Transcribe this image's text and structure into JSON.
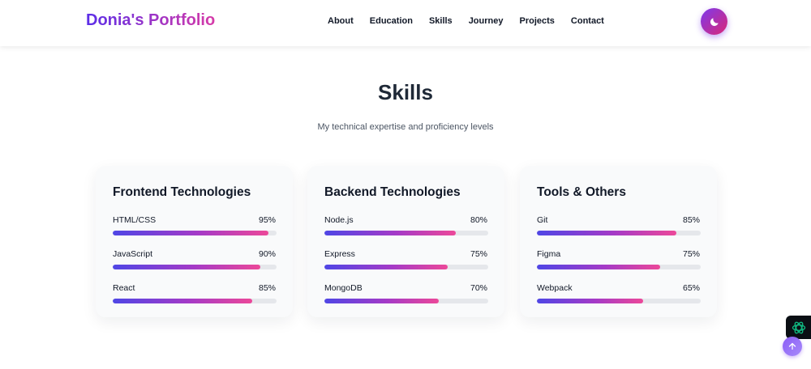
{
  "nav": {
    "brand": "Donia's Portfolio",
    "links": [
      "About",
      "Education",
      "Skills",
      "Journey",
      "Projects",
      "Contact"
    ],
    "theme_toggle_icon": "moon-icon"
  },
  "section": {
    "title": "Skills",
    "subtitle": "My technical expertise and proficiency levels"
  },
  "cards": [
    {
      "title": "Frontend Technologies",
      "skills": [
        {
          "name": "HTML/CSS",
          "percent_label": "95%",
          "level": 95
        },
        {
          "name": "JavaScript",
          "percent_label": "90%",
          "level": 90
        },
        {
          "name": "React",
          "percent_label": "85%",
          "level": 85
        }
      ]
    },
    {
      "title": "Backend Technologies",
      "skills": [
        {
          "name": "Node.js",
          "percent_label": "80%",
          "level": 80
        },
        {
          "name": "Express",
          "percent_label": "75%",
          "level": 75
        },
        {
          "name": "MongoDB",
          "percent_label": "70%",
          "level": 70
        }
      ]
    },
    {
      "title": "Tools & Others",
      "skills": [
        {
          "name": "Git",
          "percent_label": "85%",
          "level": 85
        },
        {
          "name": "Figma",
          "percent_label": "75%",
          "level": 75
        },
        {
          "name": "Webpack",
          "percent_label": "65%",
          "level": 65
        }
      ]
    }
  ],
  "widgets": {
    "side_icon": "openai-logo-icon",
    "scroll_top_icon": "arrow-up-icon"
  },
  "colors": {
    "accent_start": "#4f46e5",
    "accent_end": "#ec4899",
    "track": "#e5e7eb"
  }
}
